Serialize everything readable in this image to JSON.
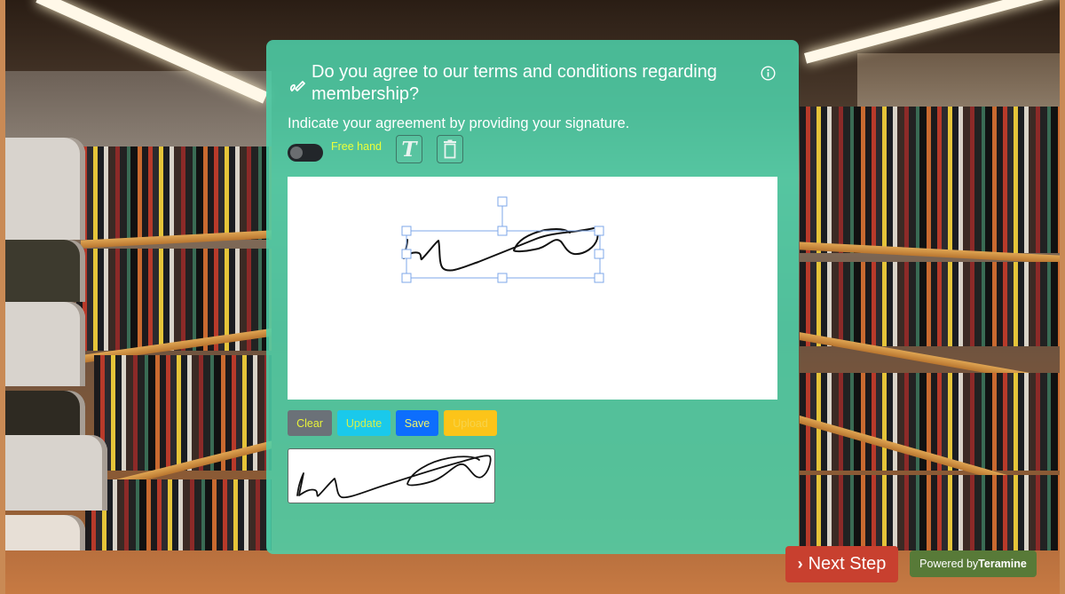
{
  "form": {
    "title": "Do you agree to our terms and conditions regarding membership?",
    "subtitle": "Indicate your agreement by providing your signature.",
    "icons": {
      "title_icon": "signature-pen-icon",
      "info": "info-circle-icon",
      "text_tool": "text-T-icon",
      "trash": "trash-icon"
    },
    "mode_toggle": {
      "label": "Free hand",
      "enabled": false
    },
    "actions": {
      "clear": "Clear",
      "update": "Update",
      "save": "Save",
      "upload": "Upload"
    }
  },
  "footer": {
    "next_step_label": "Next Step",
    "next_step_icon": "chevron-right-icon",
    "powered_by_prefix": "Powered by",
    "powered_by_brand": "Teramine"
  },
  "colors": {
    "card_bg": "#4dd2aa",
    "toggle_label": "#eaff3a",
    "clear_btn": "#6b7178",
    "update_btn": "#1ac9eb",
    "save_btn": "#0d6efd",
    "upload_btn": "#fcc419",
    "next_btn": "#c8402f",
    "powered_bg": "#587a38"
  }
}
